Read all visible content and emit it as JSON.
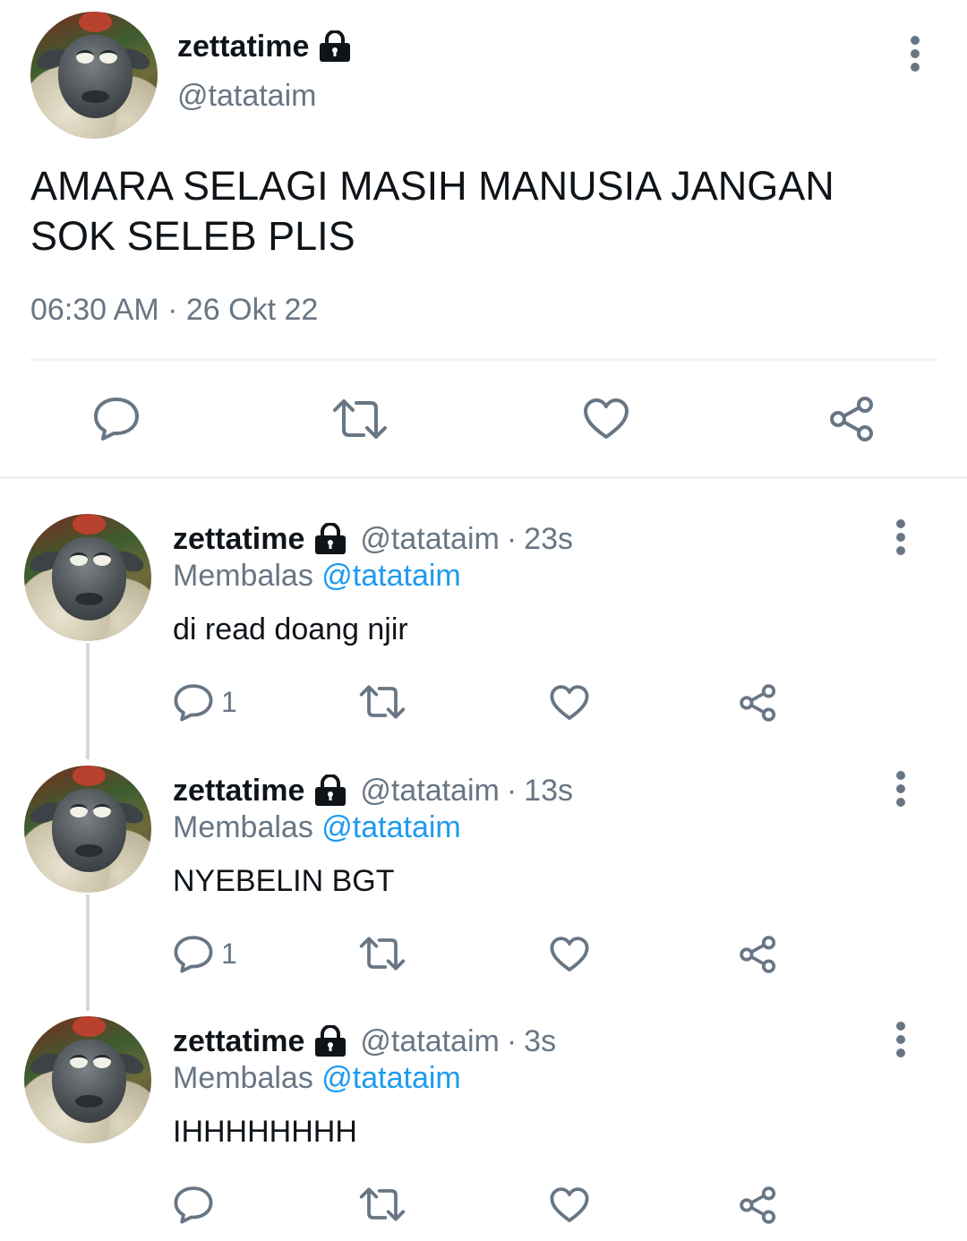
{
  "main_tweet": {
    "display_name": "zettatime",
    "handle": "@tatataim",
    "text_line1": "AMARA SELAGI MASIH MANUSIA JANGAN",
    "text_line2": "SOK SELEB PLIS",
    "time": "06:30 AM",
    "separator": "·",
    "date": "26 Okt 22"
  },
  "replies": [
    {
      "display_name": "zettatime",
      "handle": "@tatataim",
      "separator": "·",
      "age": "23s",
      "replying_prefix": "Membalas",
      "replying_to": "@tatataim",
      "text": "di read doang njir",
      "reply_count": "1"
    },
    {
      "display_name": "zettatime",
      "handle": "@tatataim",
      "separator": "·",
      "age": "13s",
      "replying_prefix": "Membalas",
      "replying_to": "@tatataim",
      "text": "NYEBELIN BGT",
      "reply_count": "1"
    },
    {
      "display_name": "zettatime",
      "handle": "@tatataim",
      "separator": "·",
      "age": "3s",
      "replying_prefix": "Membalas",
      "replying_to": "@tatataim",
      "text": "IHHHHHHHH",
      "reply_count": ""
    }
  ],
  "icons": {
    "lock": "lock-icon",
    "more": "more-vertical-icon",
    "reply": "reply-bubble-icon",
    "retweet": "retweet-icon",
    "like": "heart-icon",
    "share": "share-icon"
  },
  "colors": {
    "text": "#0f1419",
    "muted": "#687684",
    "link": "#1d9bf0",
    "divider": "#eff3f4",
    "thread_line": "#d4d9dc"
  }
}
